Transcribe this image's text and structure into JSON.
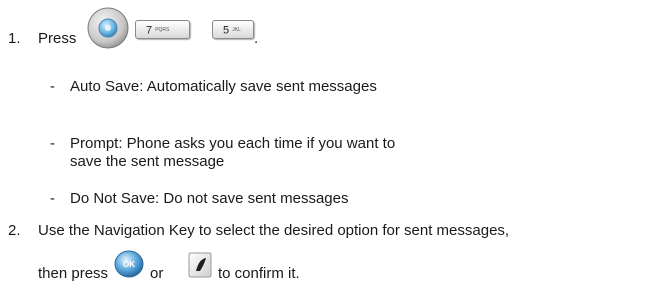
{
  "steps": [
    {
      "number": "1.",
      "text": "Press",
      "keys": [
        {
          "icon": "menu-nav-key-icon"
        },
        {
          "icon": "key-7",
          "digit": "7",
          "letters": "PQRS"
        },
        {
          "icon": "key-5",
          "digit": "5",
          "letters": "JKL"
        }
      ],
      "trailing": "."
    },
    {
      "number": "2.",
      "text": "Use the Navigation Key to select the desired option for sent messages,",
      "text2_before": "then press",
      "or": "or",
      "text2_after": "to confirm it."
    }
  ],
  "options": [
    {
      "dash": "-",
      "lines": [
        "Auto Save: Automatically save sent messages"
      ]
    },
    {
      "dash": "-",
      "lines": [
        "Prompt: Phone asks you each time if you want to",
        "save the sent message"
      ]
    },
    {
      "dash": "-",
      "lines": [
        "Do Not Save: Do not save sent messages"
      ]
    }
  ],
  "icons": {
    "ok": "ok-key-icon",
    "send": "send-key-icon"
  }
}
